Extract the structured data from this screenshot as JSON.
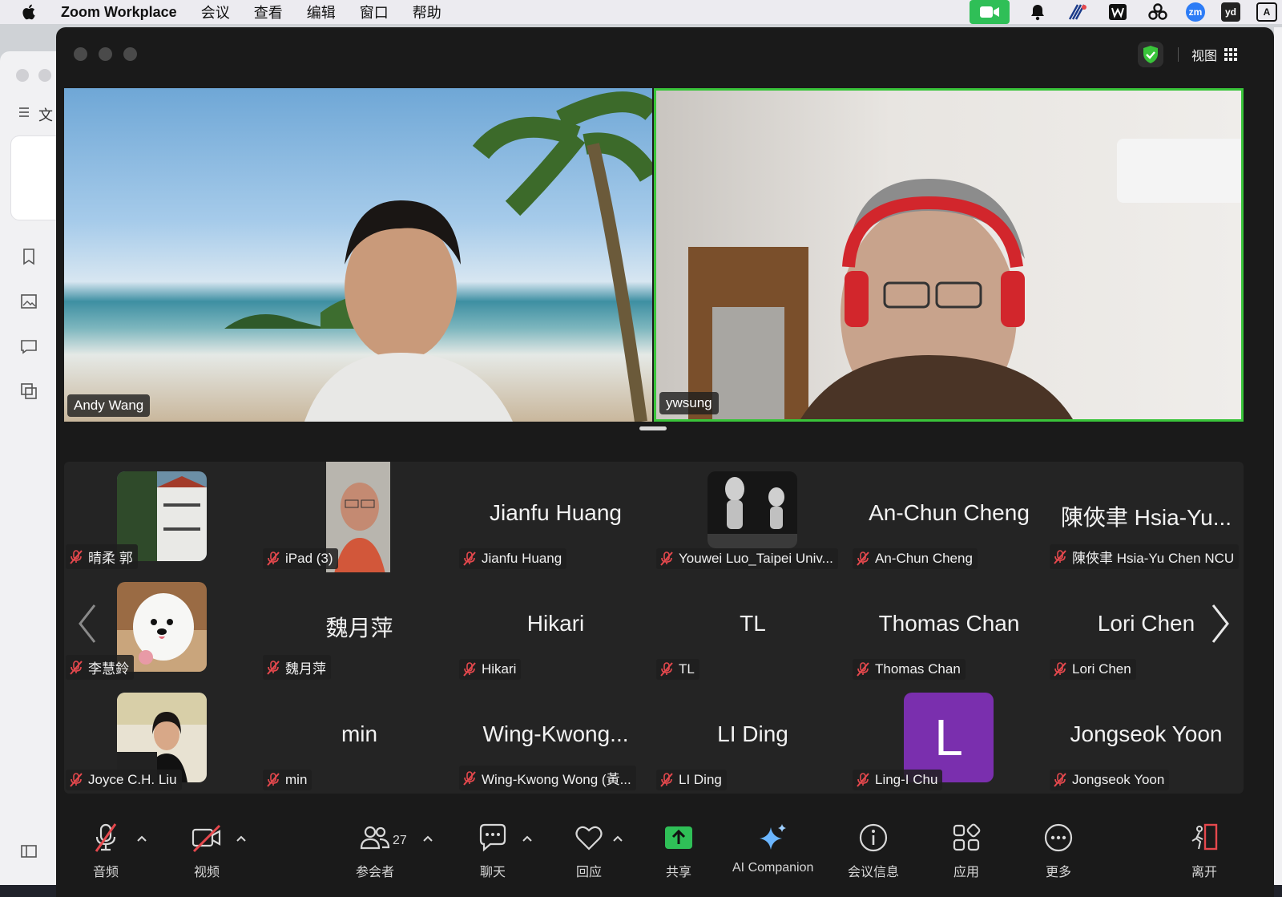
{
  "menubar": {
    "app_name": "Zoom Workplace",
    "items": [
      "会议",
      "查看",
      "编辑",
      "窗口",
      "帮助"
    ],
    "tray": [
      {
        "icon": "zoom-camera-icon",
        "color": "#2fbf57"
      },
      {
        "icon": "bell-icon",
        "color": "#ecebf0"
      },
      {
        "icon": "grid-app-icon",
        "color": "#ecebf0"
      },
      {
        "icon": "w-app-icon",
        "color": "#ecebf0"
      },
      {
        "icon": "cluster-icon",
        "color": "#ecebf0"
      },
      {
        "text": "zm",
        "icon": "zm-app-icon",
        "color": "#2d7cf6"
      },
      {
        "text": "yd",
        "icon": "yd-app-icon",
        "color": "#222222"
      },
      {
        "text": "A",
        "icon": "input-method-icon",
        "color": "#ecebf0"
      }
    ]
  },
  "background_app": {
    "sidebar_text": "文"
  },
  "window": {
    "view_label": "视图",
    "security_color": "#39c43a"
  },
  "speakers": [
    {
      "name": "Andy Wang"
    },
    {
      "name": "ywsung",
      "active_color": "#39c43a"
    }
  ],
  "gallery": {
    "rows": [
      [
        {
          "label": "晴柔 郭",
          "thumb": "building"
        },
        {
          "label": "iPad (3)",
          "thumb": "face"
        },
        {
          "label": "Jianfu Huang",
          "big": "Jianfu Huang"
        },
        {
          "label": "Youwei Luo_Taipei Univ...",
          "thumb": "statues"
        },
        {
          "label": "An-Chun Cheng",
          "big": "An-Chun Cheng"
        },
        {
          "label": "陳俠聿 Hsia-Yu Chen NCU",
          "big": "陳俠聿 Hsia-Yu..."
        }
      ],
      [
        {
          "label": "李慧鈴",
          "thumb": "dog"
        },
        {
          "label": "魏月萍",
          "big": "魏月萍"
        },
        {
          "label": "Hikari",
          "big": "Hikari"
        },
        {
          "label": "TL",
          "big": "TL"
        },
        {
          "label": "Thomas Chan",
          "big": "Thomas Chan"
        },
        {
          "label": "Lori Chen",
          "big": "Lori Chen"
        }
      ],
      [
        {
          "label": "Joyce C.H. Liu",
          "thumb": "woman"
        },
        {
          "label": "min",
          "big": "min"
        },
        {
          "label": "Wing-Kwong Wong (黃...",
          "big": "Wing-Kwong..."
        },
        {
          "label": "LI Ding",
          "big": "LI Ding"
        },
        {
          "label": "Ling-I Chu",
          "avatar": "L",
          "avatar_color": "#7a2fae"
        },
        {
          "label": "Jongseok Yoon",
          "big": "Jongseok Yoon"
        }
      ]
    ]
  },
  "toolbar": {
    "audio": "音频",
    "video": "视频",
    "participants": "参会者",
    "participant_count": "27",
    "chat": "聊天",
    "react": "回应",
    "share": "共享",
    "ai": "AI Companion",
    "info": "会议信息",
    "apps": "应用",
    "more": "更多",
    "leave": "离开",
    "share_color": "#2fbf57",
    "leave_color": "#e5484d",
    "mute_color": "#e5484d"
  }
}
